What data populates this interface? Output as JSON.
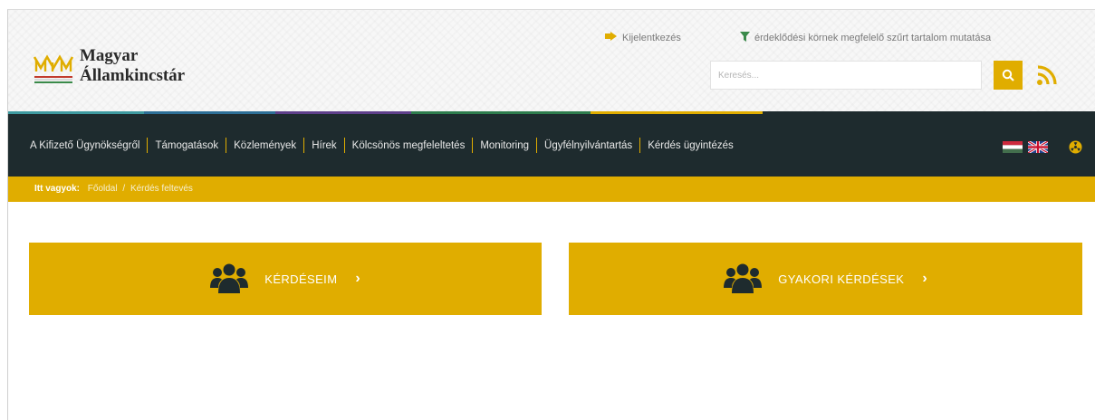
{
  "brand": {
    "line1": "Magyar",
    "line2": "Államkincstár",
    "accent_color": "#e0ad00"
  },
  "utility": {
    "logout_label": "Kijelentkezés",
    "filter_label": "érdeklődési körnek megfelelő szűrt tartalom mutatása",
    "search_placeholder": "Keresés...",
    "search_icon": "search-icon",
    "rss_icon": "rss-icon"
  },
  "nav": {
    "items": [
      "A Kifizető Ügynökségről",
      "Támogatások",
      "Közlemények",
      "Hírek",
      "Kölcsönös megfeleltetés",
      "Monitoring",
      "Ügyfélnyilvántartás",
      "Kérdés ügyintézés"
    ],
    "flags": [
      "hungarian-flag",
      "uk-flag"
    ],
    "hazard_icon": "radiation-icon",
    "background": "#1e2b2e"
  },
  "breadcrumb": {
    "prefix": "Itt vagyok:",
    "items": [
      "Főoldal",
      "Kérdés feltevés"
    ],
    "separator": "/"
  },
  "cards": [
    {
      "label": "KÉRDÉSEIM",
      "icon": "users-icon",
      "chevron": "›"
    },
    {
      "label": "GYAKORI KÉRDÉSEK",
      "icon": "users-icon",
      "chevron": "›"
    }
  ]
}
